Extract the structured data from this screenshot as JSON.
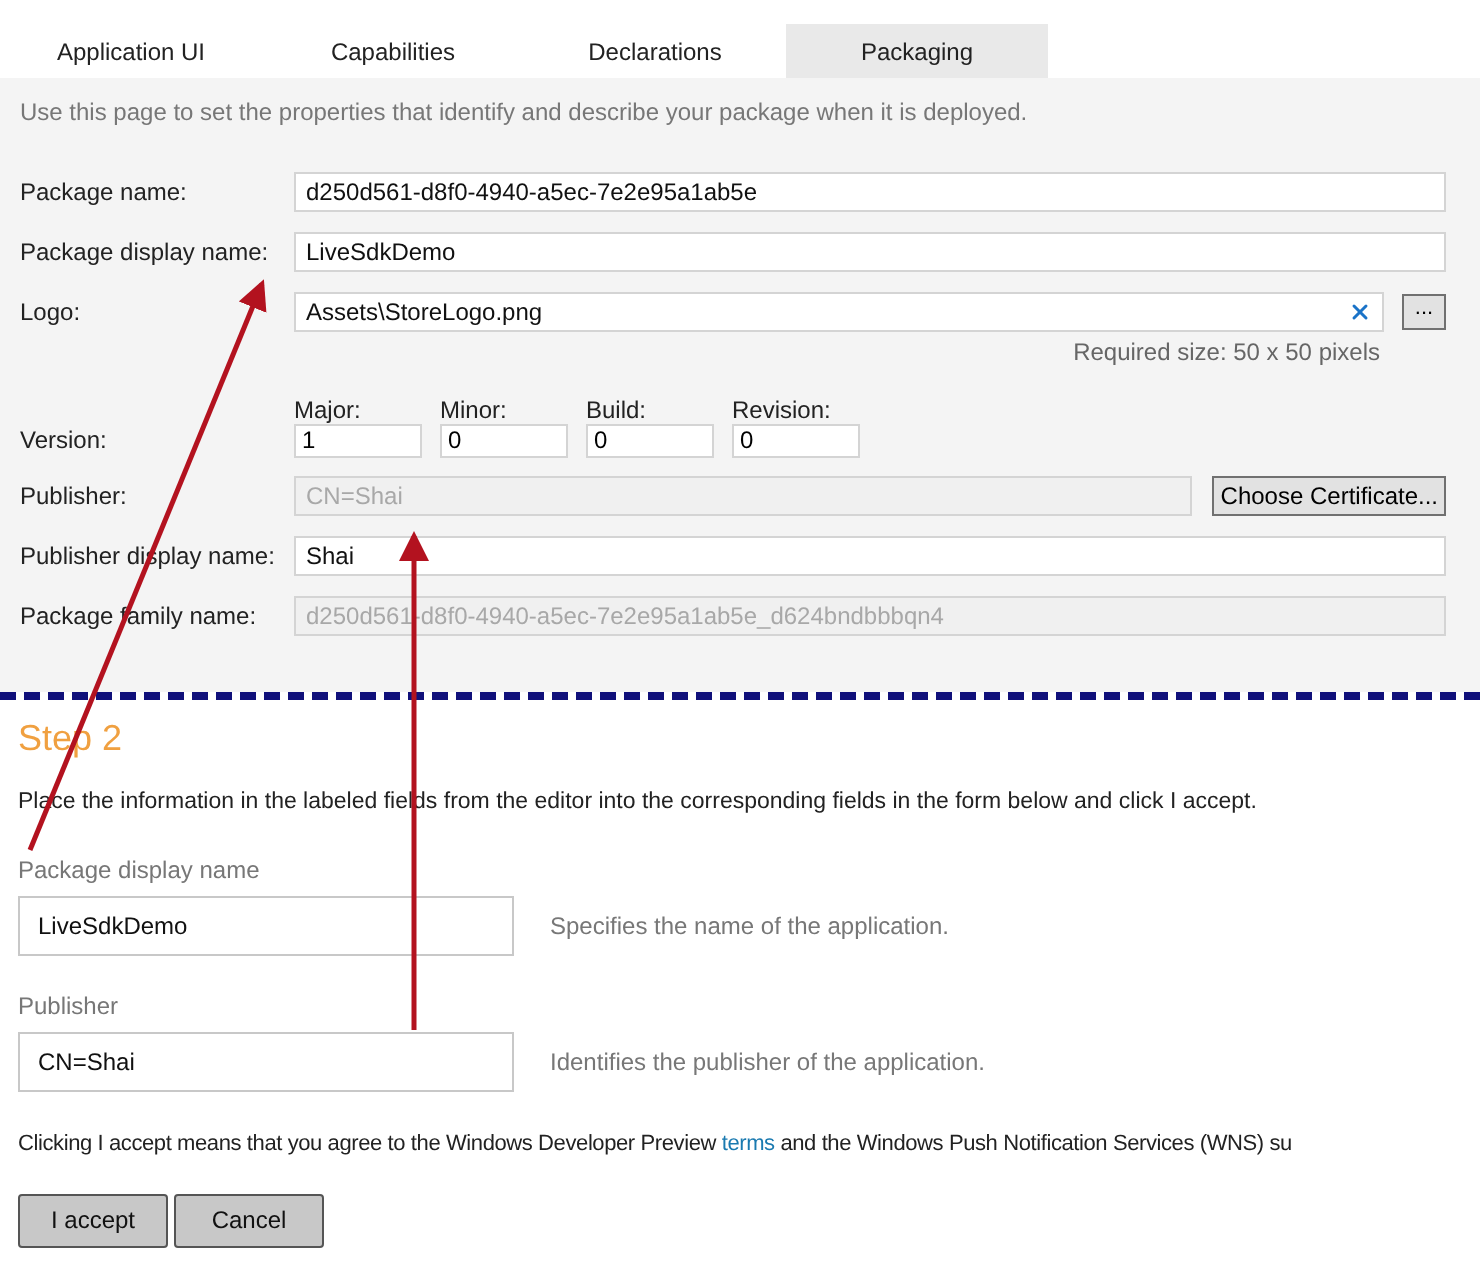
{
  "tabs": [
    {
      "label": "Application UI",
      "selected": false
    },
    {
      "label": "Capabilities",
      "selected": false
    },
    {
      "label": "Declarations",
      "selected": false
    },
    {
      "label": "Packaging",
      "selected": true
    }
  ],
  "intro": "Use this page to set the properties that identify and describe your package when it is deployed.",
  "fields": [
    {
      "kind": "text",
      "label": "Package name:",
      "value": "d250d561-d8f0-4940-a5ec-7e2e95a1ab5e",
      "disabled": false
    },
    {
      "kind": "text",
      "label": "Package display name:",
      "value": "LiveSdkDemo",
      "disabled": false
    },
    {
      "kind": "logo",
      "label": "Logo:",
      "value": "Assets\\StoreLogo.png",
      "browse": "...",
      "note": "Required size: 50 x 50 pixels"
    },
    {
      "kind": "version",
      "label": "Version:",
      "parts": [
        {
          "label": "Major:",
          "value": "1"
        },
        {
          "label": "Minor:",
          "value": "0"
        },
        {
          "label": "Build:",
          "value": "0"
        },
        {
          "label": "Revision:",
          "value": "0"
        }
      ]
    },
    {
      "kind": "publisher",
      "label": "Publisher:",
      "value": "CN=Shai",
      "disabled": true,
      "button": "Choose Certificate..."
    },
    {
      "kind": "text",
      "label": "Publisher display name:",
      "value": "Shai",
      "disabled": false
    },
    {
      "kind": "text",
      "label": "Package family name:",
      "value": "d250d561-d8f0-4940-a5ec-7e2e95a1ab5e_d624bndbbbqn4",
      "disabled": true
    }
  ],
  "step": {
    "title": "Step 2",
    "instructions": "Place the information in the labeled fields from the editor into the corresponding fields in the form below and click I accept.",
    "fields": [
      {
        "label": "Package display name",
        "value": "LiveSdkDemo",
        "hint": "Specifies the name of the application."
      },
      {
        "label": "Publisher",
        "value": "CN=Shai",
        "hint": "Identifies the publisher of the application."
      }
    ],
    "agreement": {
      "before": "Clicking I accept means that you agree to the Windows Developer Preview ",
      "link": "terms",
      "after": " and the Windows Push Notification Services (WNS) su"
    },
    "buttons": [
      "I accept",
      "Cancel"
    ]
  }
}
